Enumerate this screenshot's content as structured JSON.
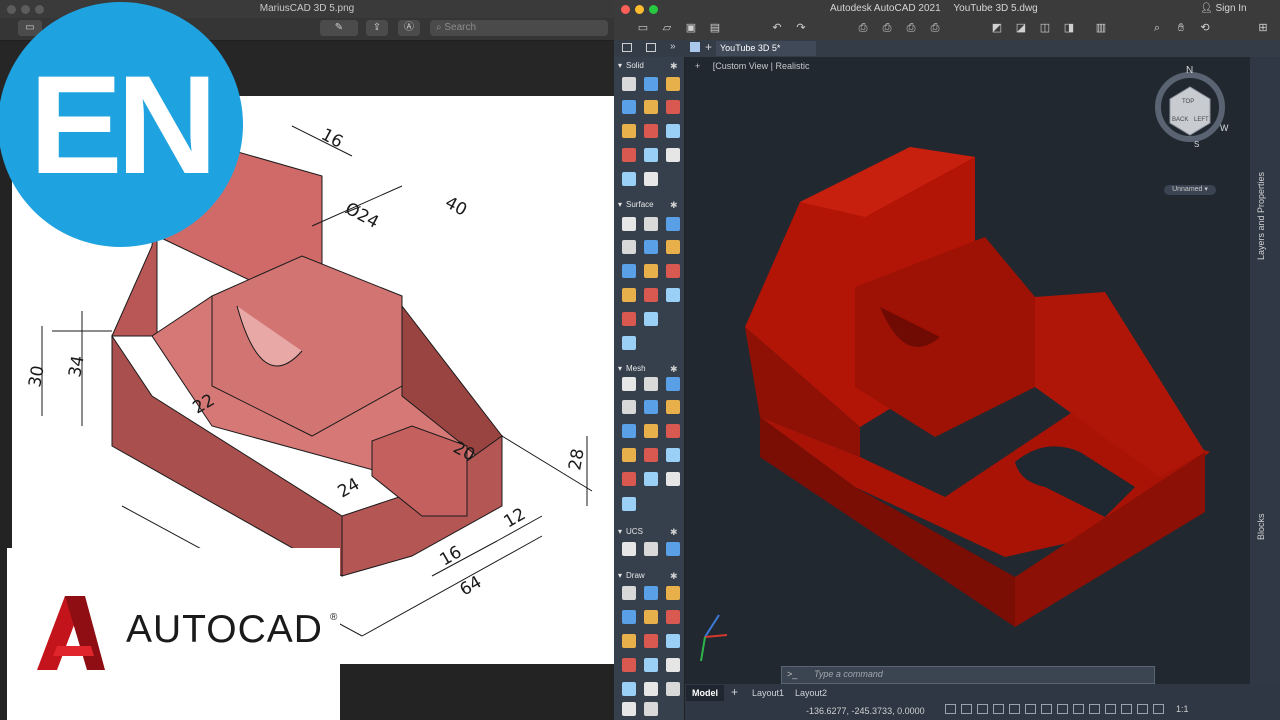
{
  "thumbnail": {
    "badge": "EN",
    "logo_text": "AUTOCAD",
    "logo_reg": "®"
  },
  "viewer": {
    "title": "MariusCAD 3D 5.png",
    "search_placeholder": "Search"
  },
  "drawing": {
    "dimensions": [
      "16",
      "40",
      "Ø24",
      "30",
      "34",
      "22",
      "20",
      "28",
      "24",
      "12",
      "16",
      "64"
    ]
  },
  "autocad": {
    "title": "Autodesk AutoCAD 2021",
    "file": "YouTube 3D 5.dwg",
    "sign_in": "Sign In",
    "doc_tab": "YouTube 3D 5*",
    "viewport_label_left": "Custom View",
    "viewport_label_right": "Realistic",
    "viewport_prefix": "+",
    "viewcube": {
      "top": "TOP",
      "back": "BACK",
      "left": "LEFT",
      "n": "N",
      "s": "S",
      "w": "W"
    },
    "unnamed": "Unnamed",
    "side_panels": [
      "Layers and Properties",
      "Blocks"
    ],
    "palette_sections": [
      "Solid",
      "Surface",
      "Mesh",
      "UCS",
      "Draw"
    ],
    "command_prompt": ">_",
    "command_placeholder": "Type a command",
    "layout_tabs": [
      "Model",
      "Layout1",
      "Layout2"
    ],
    "coordinates": "-136.6277, -245.3733, 0.0000",
    "scale": "1:1",
    "colors": {
      "solid_red": "#b21406",
      "viewport_bg": "#212830",
      "drawing_fill": "#cf6a69"
    }
  }
}
